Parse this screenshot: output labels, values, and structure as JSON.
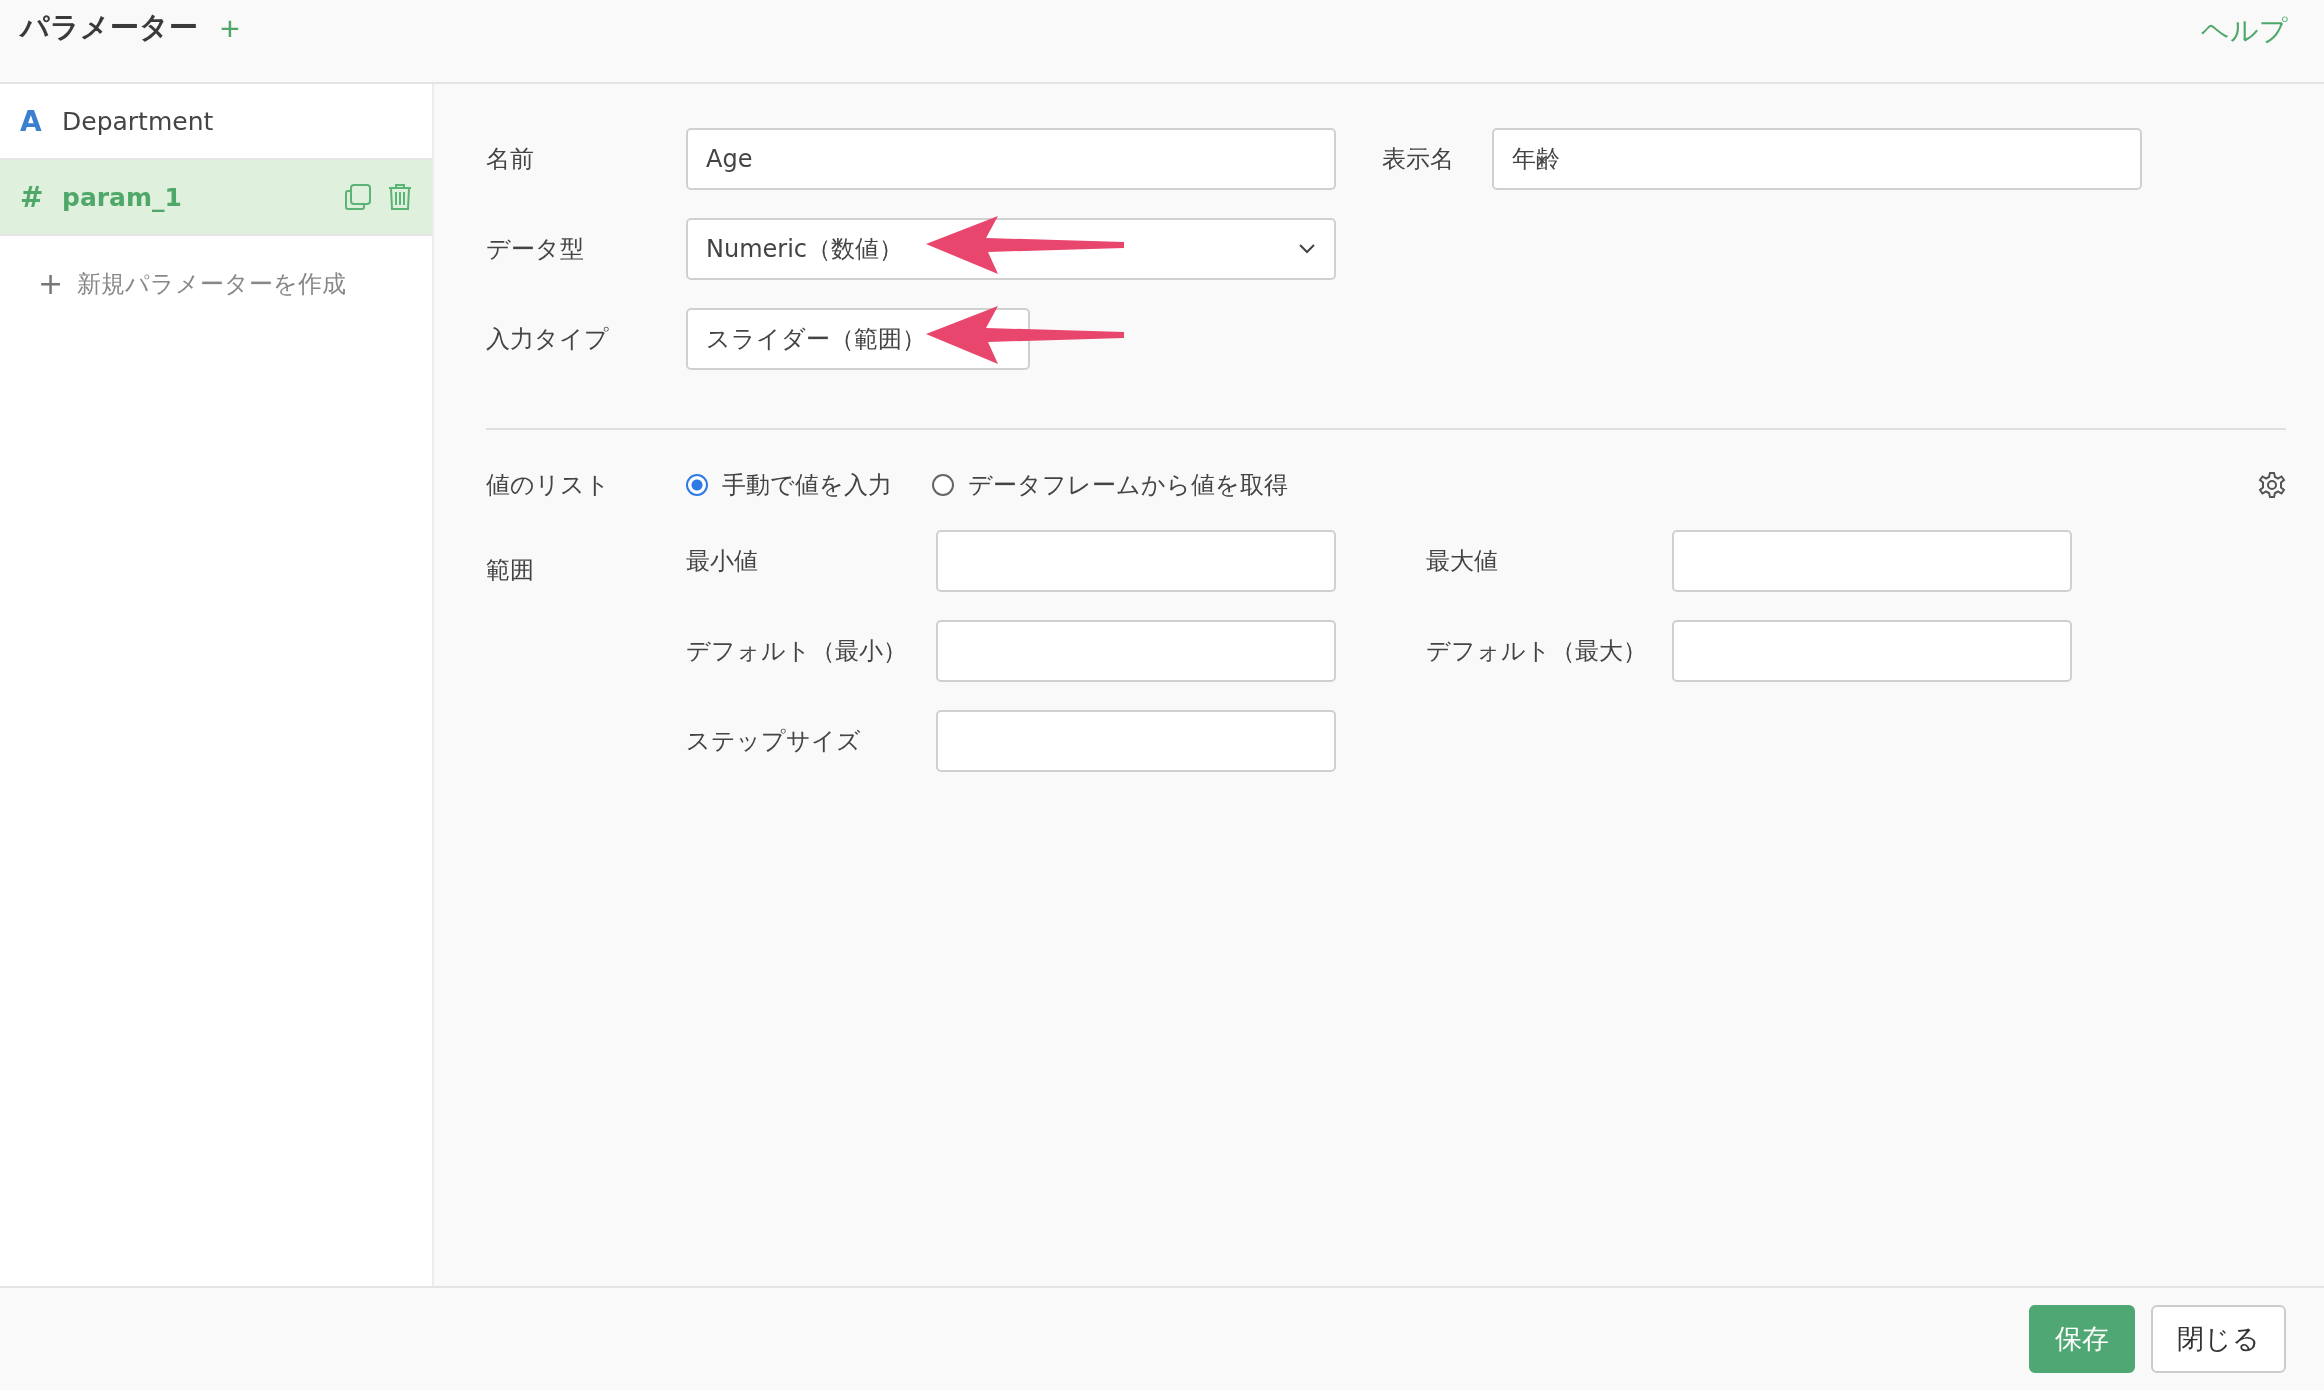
{
  "header": {
    "title": "パラメーター",
    "add_symbol": "+",
    "help": "ヘルプ"
  },
  "sidebar": {
    "items": [
      {
        "kind": "text",
        "icon": "A",
        "label": "Department",
        "selected": false
      },
      {
        "kind": "numeric",
        "icon": "#",
        "label": "param_1",
        "selected": true
      }
    ],
    "new_item": {
      "symbol": "+",
      "label": "新規パラメーターを作成"
    }
  },
  "form": {
    "name": {
      "label": "名前",
      "value": "Age"
    },
    "display_name": {
      "label": "表示名",
      "value": "年齢"
    },
    "data_type": {
      "label": "データ型",
      "value": "Numeric（数値）"
    },
    "input_type": {
      "label": "入力タイプ",
      "value": "スライダー（範囲）"
    },
    "value_list": {
      "label": "値のリスト",
      "options": [
        {
          "label": "手動で値を入力",
          "selected": true
        },
        {
          "label": "データフレームから値を取得",
          "selected": false
        }
      ]
    },
    "range": {
      "label": "範囲",
      "fields": [
        {
          "label": "最小値"
        },
        {
          "label": "最大値"
        },
        {
          "label": "デフォルト（最小）"
        },
        {
          "label": "デフォルト（最大）"
        },
        {
          "label": "ステップサイズ"
        }
      ]
    }
  },
  "footer": {
    "buttons": [
      {
        "kind": "primary",
        "label": "保存"
      },
      {
        "kind": "default",
        "label": "閉じる"
      }
    ]
  }
}
